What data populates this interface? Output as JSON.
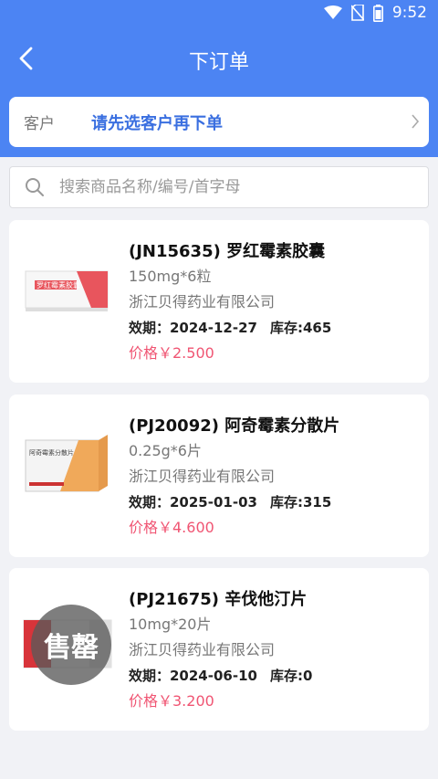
{
  "status": {
    "time": "9:52"
  },
  "nav": {
    "title": "下订单"
  },
  "customer": {
    "label": "客户",
    "value": "请先选客户再下单"
  },
  "search": {
    "placeholder": "搜索商品名称/编号/首字母"
  },
  "products": [
    {
      "title": "(JN15635) 罗红霉素胶囊",
      "spec": "150mg*6粒",
      "maker": "浙江贝得药业有限公司",
      "expiry": "效期：2024-12-27",
      "stock": "库存:465",
      "price": "价格￥2.500",
      "box_text": "罗红霉素胶囊",
      "sold_out": ""
    },
    {
      "title": "(PJ20092) 阿奇霉素分散片",
      "spec": "0.25g*6片",
      "maker": "浙江贝得药业有限公司",
      "expiry": "效期：2025-01-03",
      "stock": "库存:315",
      "price": "价格￥4.600",
      "box_text": "阿奇霉素分散片",
      "sold_out": ""
    },
    {
      "title": "(PJ21675) 辛伐他汀片",
      "spec": "10mg*20片",
      "maker": "浙江贝得药业有限公司",
      "expiry": "效期：2024-06-10",
      "stock": "库存:0",
      "price": "价格￥3.200",
      "box_text": "",
      "sold_out": "售罄"
    }
  ],
  "colors": {
    "header": "#4c84f3",
    "accent": "#3a6fe0",
    "price": "#f05573"
  }
}
